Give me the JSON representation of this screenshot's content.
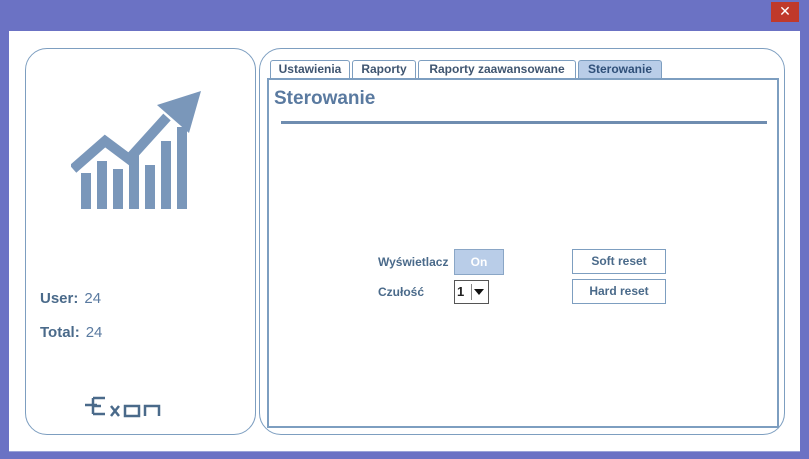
{
  "window": {
    "close_glyph": "✕",
    "colors": {
      "frame": "#6b72c4",
      "close": "#c0392b",
      "accent": "#6f8db0",
      "tab_active": "#b9cde8"
    }
  },
  "left": {
    "icon": "trending-chart-icon",
    "user_label": "User:",
    "user_value": "24",
    "total_label": "Total:",
    "total_value": "24",
    "logo_icon": "exon-logo"
  },
  "tabs": [
    {
      "label": "Ustawienia",
      "active": false
    },
    {
      "label": "Raporty",
      "active": false
    },
    {
      "label": "Raporty zaawansowane",
      "active": false
    },
    {
      "label": "Sterowanie",
      "active": true
    }
  ],
  "content": {
    "title": "Sterowanie",
    "display_label": "Wyświetlacz",
    "display_toggle": "On",
    "sensitivity_label": "Czułość",
    "sensitivity_value": "1",
    "soft_reset": "Soft reset",
    "hard_reset": "Hard reset"
  }
}
